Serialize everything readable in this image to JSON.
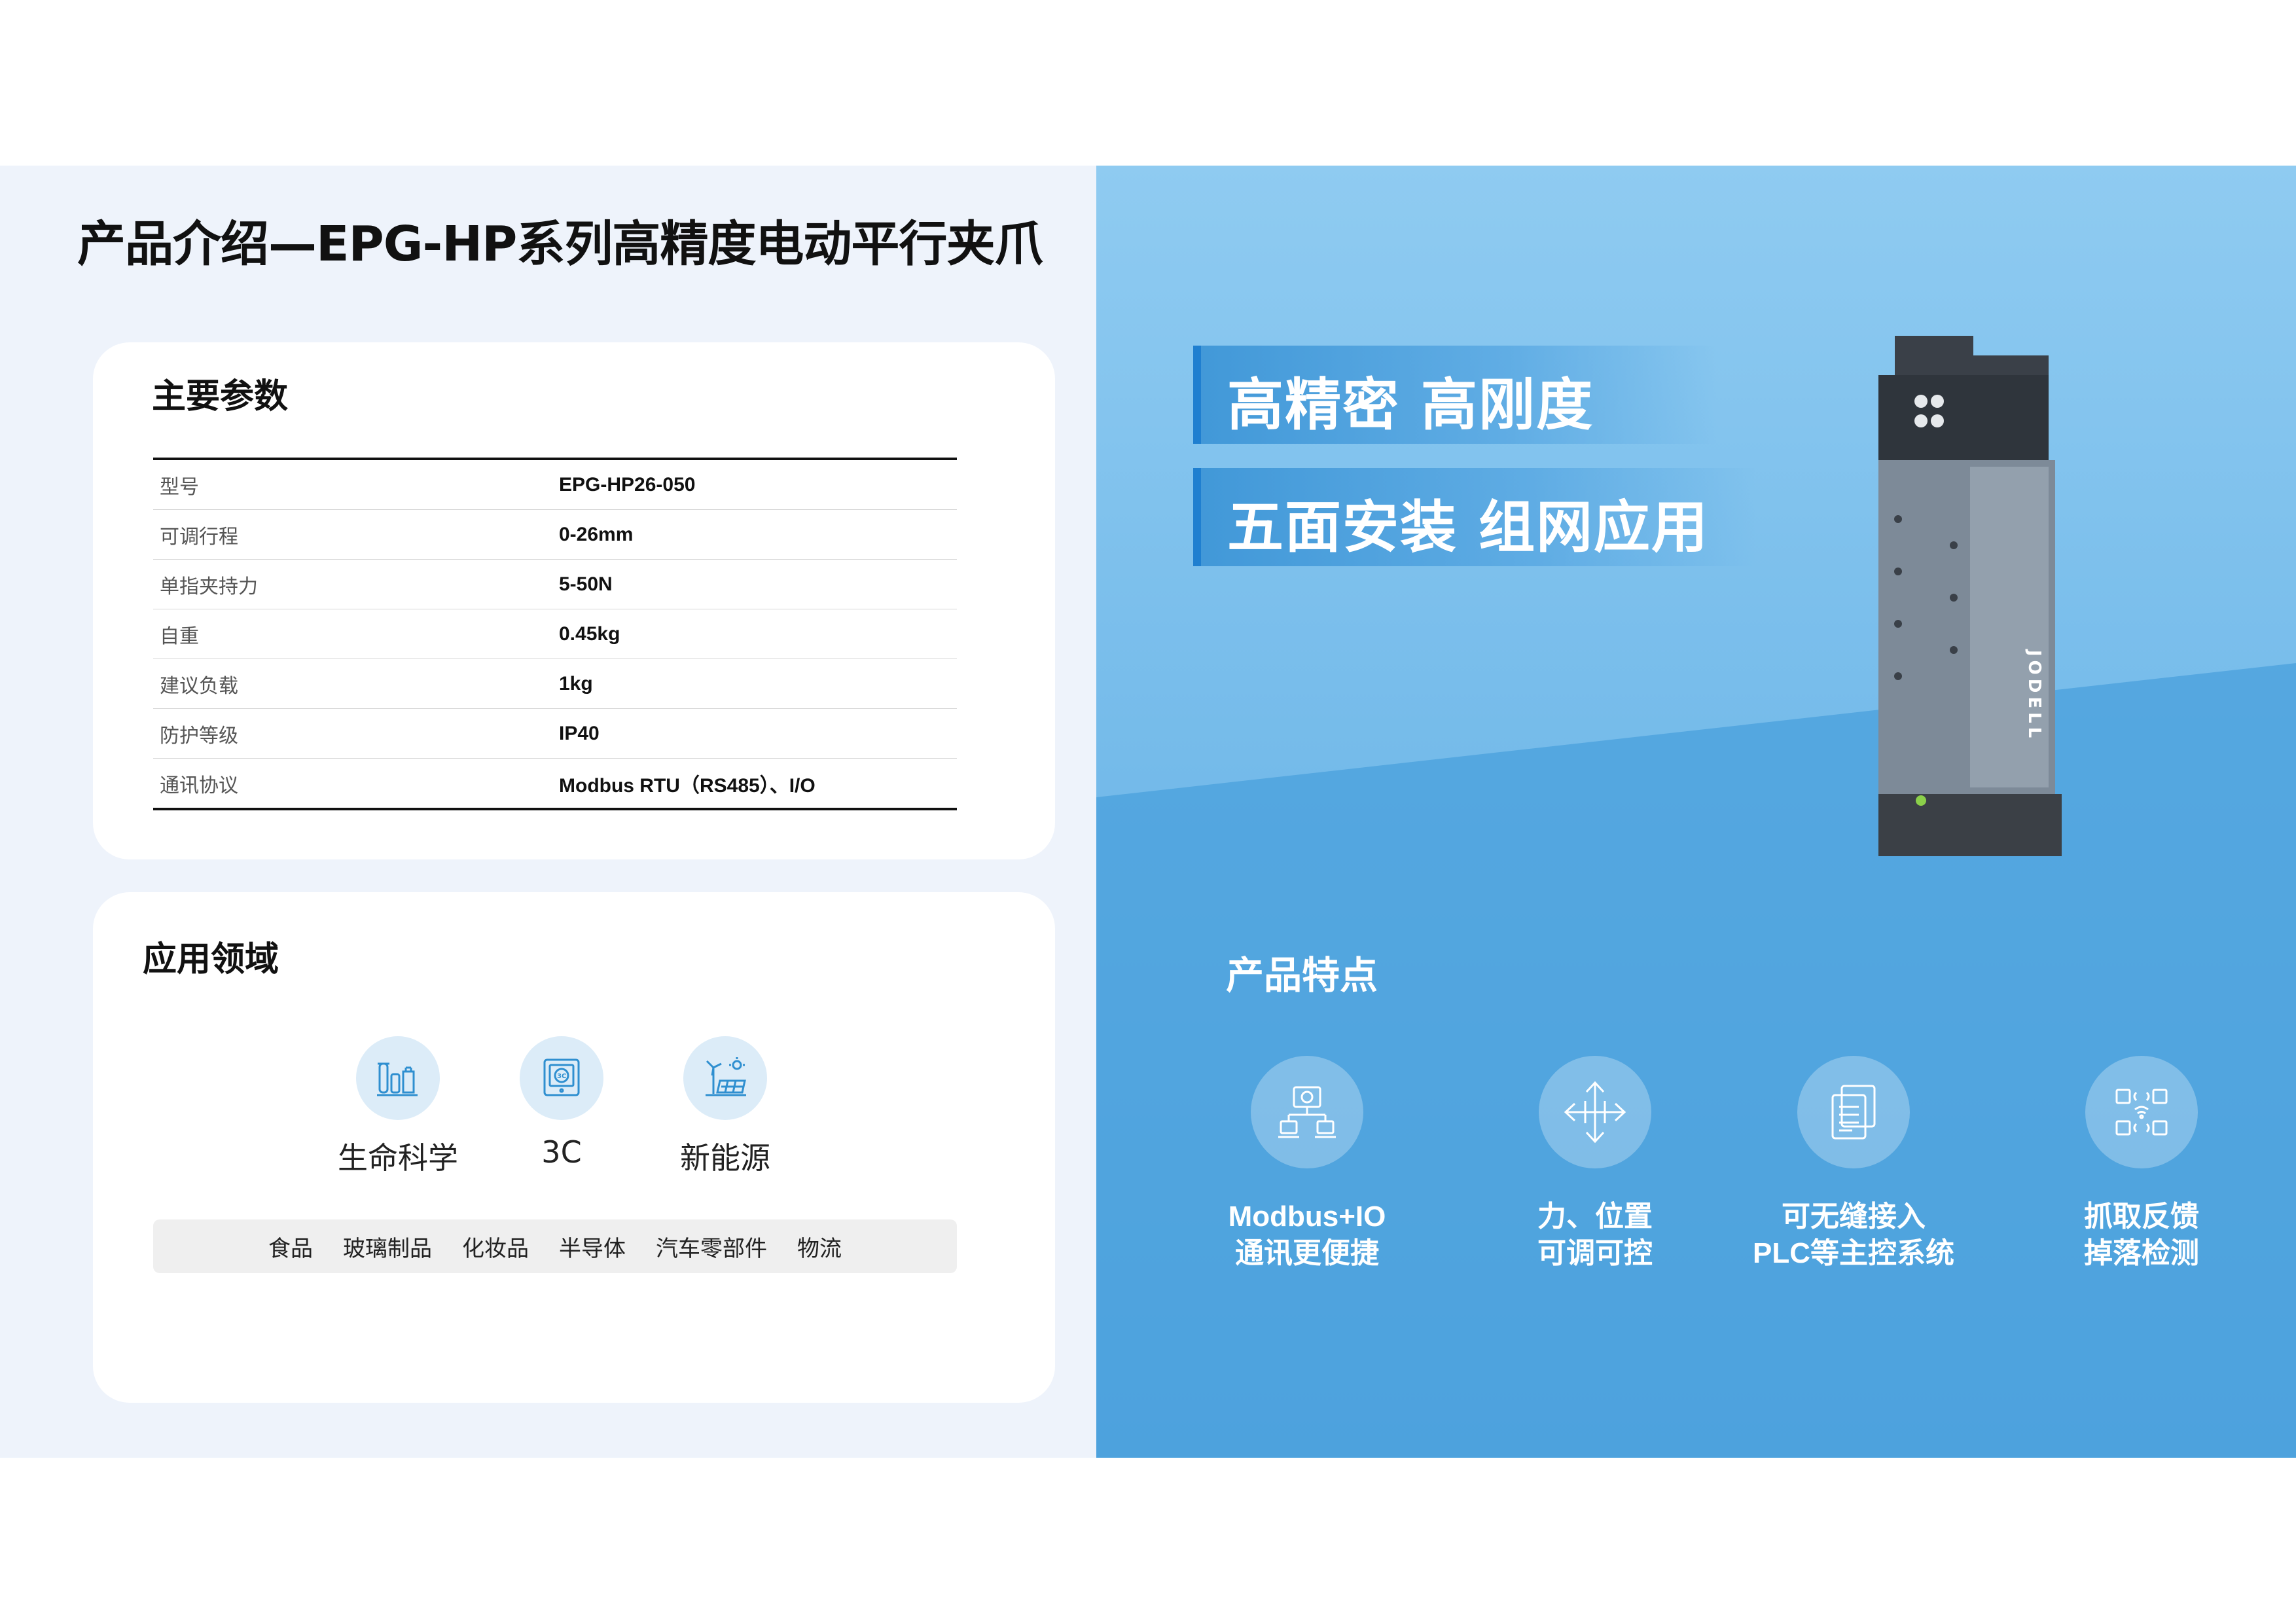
{
  "page": {
    "title": "产品介绍—EPG-HP系列高精度电动平行夹爪"
  },
  "params": {
    "title": "主要参数",
    "rows": [
      {
        "label": "型号",
        "value": "EPG-HP26-050"
      },
      {
        "label": "可调行程",
        "value": "0-26mm"
      },
      {
        "label": "单指夹持力",
        "value": "5-50N"
      },
      {
        "label": "自重",
        "value": "0.45kg"
      },
      {
        "label": "建议负载",
        "value": "1kg"
      },
      {
        "label": "防护等级",
        "value": "IP40"
      },
      {
        "label": "通讯协议",
        "value": "Modbus RTU（RS485）、I/O"
      }
    ]
  },
  "applications": {
    "title": "应用领域",
    "items": [
      {
        "label": "生命科学",
        "icon": "test-tubes-icon"
      },
      {
        "label": "3C",
        "icon": "3c-device-icon"
      },
      {
        "label": "新能源",
        "icon": "wind-solar-icon"
      }
    ],
    "industries": [
      "食品",
      "玻璃制品",
      "化妆品",
      "半导体",
      "汽车零部件",
      "物流"
    ]
  },
  "slogans": [
    "高精密  高刚度",
    "五面安装  组网应用"
  ],
  "product": {
    "brand": "JODELL"
  },
  "features": {
    "title": "产品特点",
    "items": [
      {
        "line1": "Modbus+IO",
        "line2": "通讯更便捷",
        "icon": "network-devices-icon"
      },
      {
        "line1": "力、位置",
        "line2": "可调可控",
        "icon": "four-way-arrows-icon"
      },
      {
        "line1": "可无缝接入",
        "line2": "PLC等主控系统",
        "icon": "documents-icon"
      },
      {
        "line1": "抓取反馈",
        "line2": "掉落检测",
        "icon": "sensor-chips-icon"
      }
    ]
  },
  "colors": {
    "left_background": "#eef3fb",
    "right_background": "#78bdeb",
    "accent_blue": "#1f7fd0",
    "icon_blue": "#2f8fd0"
  }
}
